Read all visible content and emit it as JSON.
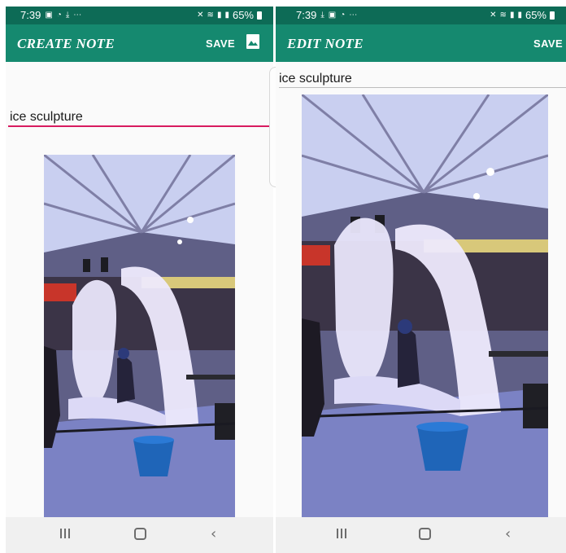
{
  "screens": [
    {
      "status": {
        "time": "7:39",
        "battery": "65%"
      },
      "header": {
        "title": "CREATE NOTE",
        "save_label": "SAVE"
      },
      "note": {
        "title_value": "ice sculpture"
      }
    },
    {
      "status": {
        "time": "7:39",
        "battery": "65%"
      },
      "header": {
        "title": "EDIT NOTE",
        "save_label": "SAVE"
      },
      "note": {
        "title_value": "ice sculpture"
      }
    }
  ],
  "icons": {
    "header_image_button": "image-icon",
    "nav_recents": "recents-icon",
    "nav_home": "home-icon",
    "nav_back": "back-icon"
  },
  "colors": {
    "status_bar": "#0d6b56",
    "app_bar": "#15896f",
    "title_underline_focused": "#d81b60",
    "title_underline": "#bdbdbd"
  }
}
